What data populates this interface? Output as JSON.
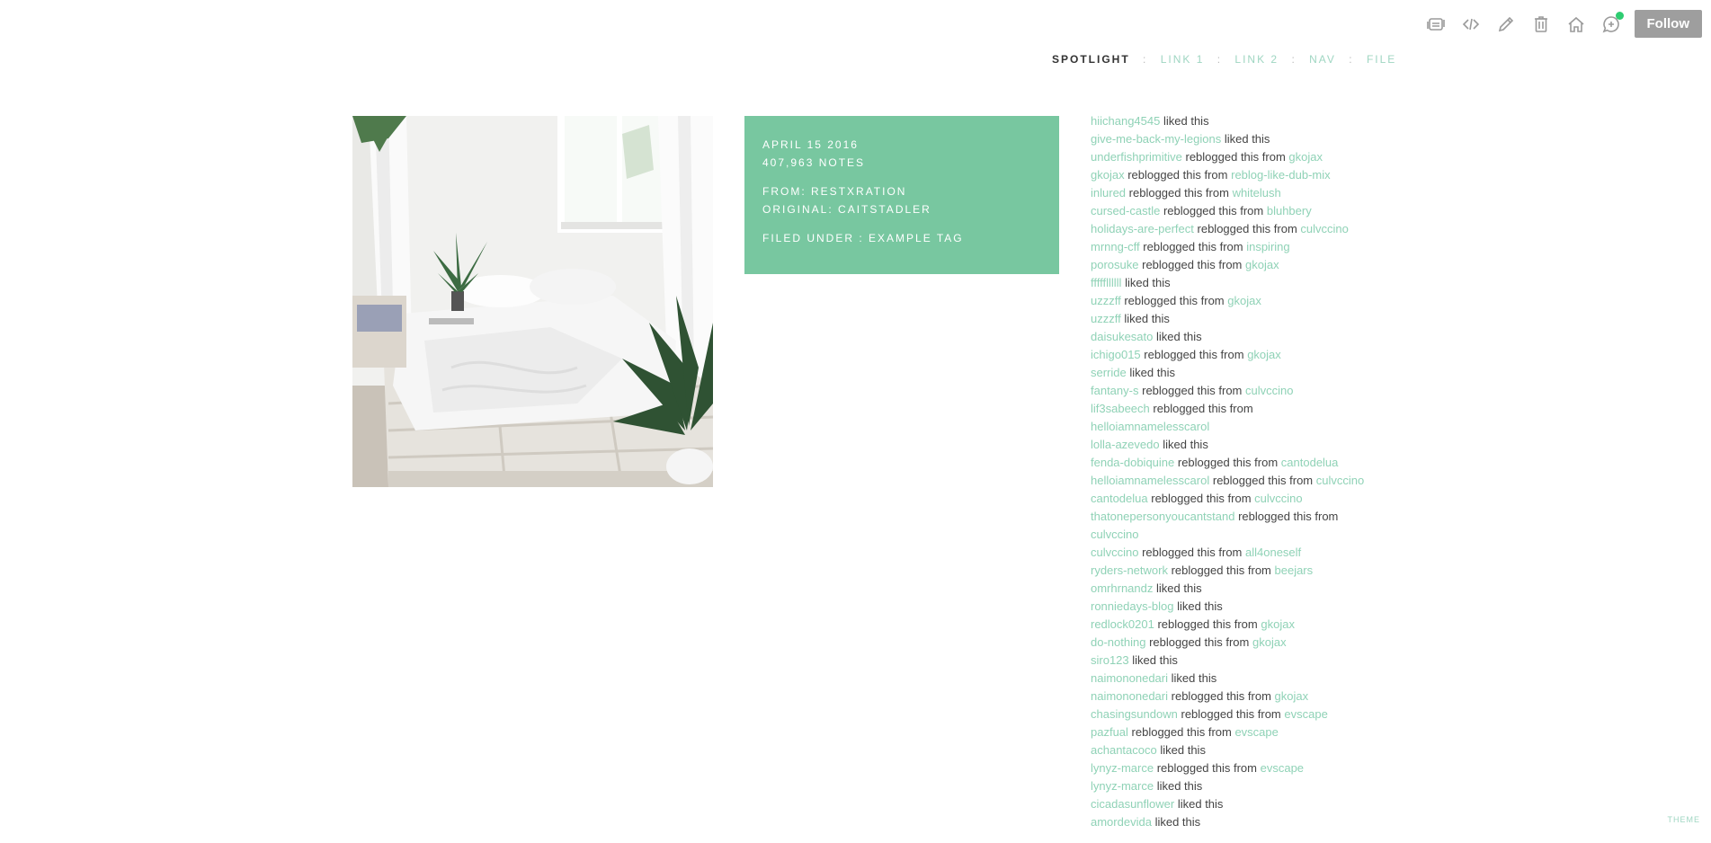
{
  "controls": {
    "icons": [
      "customize-icon",
      "embed-icon",
      "edit-icon",
      "delete-icon",
      "dashboard-home-icon",
      "message-icon"
    ],
    "follow_label": "Follow",
    "notification_color": "#2ecc71"
  },
  "nav": {
    "title": "SPOTLIGHT",
    "links": [
      "LINK 1",
      "LINK 2",
      "NAV",
      "FILE"
    ],
    "separator": ":"
  },
  "post": {
    "image_description_icon": "bedroom-photo",
    "date": "APRIL 15 2016",
    "notes_count": "407,963 NOTES",
    "from_label": "FROM:",
    "from_user": "RESTXRATION",
    "original_label": "ORIGINAL:",
    "original_user": "CAITSTADLER",
    "filed_label": "FILED UNDER :",
    "tag": "EXAMPLE TAG",
    "accent_color": "#78c7a0"
  },
  "notes": [
    {
      "user": "hiichang4545",
      "action": "liked this",
      "source": ""
    },
    {
      "user": "give-me-back-my-legions",
      "action": "liked this",
      "source": ""
    },
    {
      "user": "underfishprimitive",
      "action": "reblogged this from",
      "source": "gkojax"
    },
    {
      "user": "gkojax",
      "action": "reblogged this from",
      "source": "reblog-like-dub-mix"
    },
    {
      "user": "inlured",
      "action": "reblogged this from",
      "source": "whitelush"
    },
    {
      "user": "cursed-castle",
      "action": "reblogged this from",
      "source": "bluhbery"
    },
    {
      "user": "holidays-are-perfect",
      "action": "reblogged this from",
      "source": "culvccino"
    },
    {
      "user": "mrnng-cff",
      "action": "reblogged this from",
      "source": "inspiring"
    },
    {
      "user": "porosuke",
      "action": "reblogged this from",
      "source": "gkojax"
    },
    {
      "user": "fffffllllll",
      "action": "liked this",
      "source": ""
    },
    {
      "user": "uzzzff",
      "action": "reblogged this from",
      "source": "gkojax"
    },
    {
      "user": "uzzzff",
      "action": "liked this",
      "source": ""
    },
    {
      "user": "daisukesato",
      "action": "liked this",
      "source": ""
    },
    {
      "user": "ichigo015",
      "action": "reblogged this from",
      "source": "gkojax"
    },
    {
      "user": "serride",
      "action": "liked this",
      "source": ""
    },
    {
      "user": "fantany-s",
      "action": "reblogged this from",
      "source": "culvccino"
    },
    {
      "user": "lif3sabeech",
      "action": "reblogged this from",
      "source": "helloiamnamelesscarol"
    },
    {
      "user": "lolla-azevedo",
      "action": "liked this",
      "source": ""
    },
    {
      "user": "fenda-dobiquine",
      "action": "reblogged this from",
      "source": "cantodelua"
    },
    {
      "user": "helloiamnamelesscarol",
      "action": "reblogged this from",
      "source": "culvccino"
    },
    {
      "user": "cantodelua",
      "action": "reblogged this from",
      "source": "culvccino"
    },
    {
      "user": "thatonepersonyoucantstand",
      "action": "reblogged this from",
      "source": "culvccino"
    },
    {
      "user": "culvccino",
      "action": "reblogged this from",
      "source": "all4oneself"
    },
    {
      "user": "ryders-network",
      "action": "reblogged this from",
      "source": "beejars"
    },
    {
      "user": "omrhrnandz",
      "action": "liked this",
      "source": ""
    },
    {
      "user": "ronniedays-blog",
      "action": "liked this",
      "source": ""
    },
    {
      "user": "redlock0201",
      "action": "reblogged this from",
      "source": "gkojax"
    },
    {
      "user": "do-nothing",
      "action": "reblogged this from",
      "source": "gkojax"
    },
    {
      "user": "siro123",
      "action": "liked this",
      "source": ""
    },
    {
      "user": "naimononedari",
      "action": "liked this",
      "source": ""
    },
    {
      "user": "naimononedari",
      "action": "reblogged this from",
      "source": "gkojax"
    },
    {
      "user": "chasingsundown",
      "action": "reblogged this from",
      "source": "evscape"
    },
    {
      "user": "pazfual",
      "action": "reblogged this from",
      "source": "evscape"
    },
    {
      "user": "achantacoco",
      "action": "liked this",
      "source": ""
    },
    {
      "user": "lynyz-marce",
      "action": "reblogged this from",
      "source": "evscape"
    },
    {
      "user": "lynyz-marce",
      "action": "liked this",
      "source": ""
    },
    {
      "user": "cicadasunflower",
      "action": "liked this",
      "source": ""
    },
    {
      "user": "amordevida",
      "action": "liked this",
      "source": ""
    }
  ],
  "theme_credit": "THEME"
}
